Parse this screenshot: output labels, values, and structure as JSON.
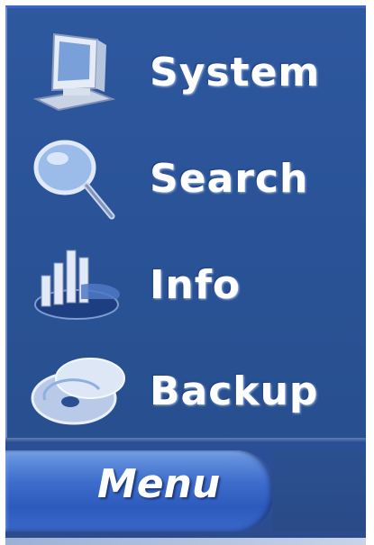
{
  "menu": {
    "items": [
      {
        "label": "System",
        "icon": "computer-monitor-icon"
      },
      {
        "label": "Search",
        "icon": "magnifier-icon"
      },
      {
        "label": "Info",
        "icon": "bar-chart-icon"
      },
      {
        "label": "Backup",
        "icon": "disc-icon"
      }
    ],
    "tab_label": "Menu"
  },
  "colors": {
    "panel_bg": "#2a5398",
    "text": "#ffffff",
    "tab_accent": "#3d6ccb"
  }
}
